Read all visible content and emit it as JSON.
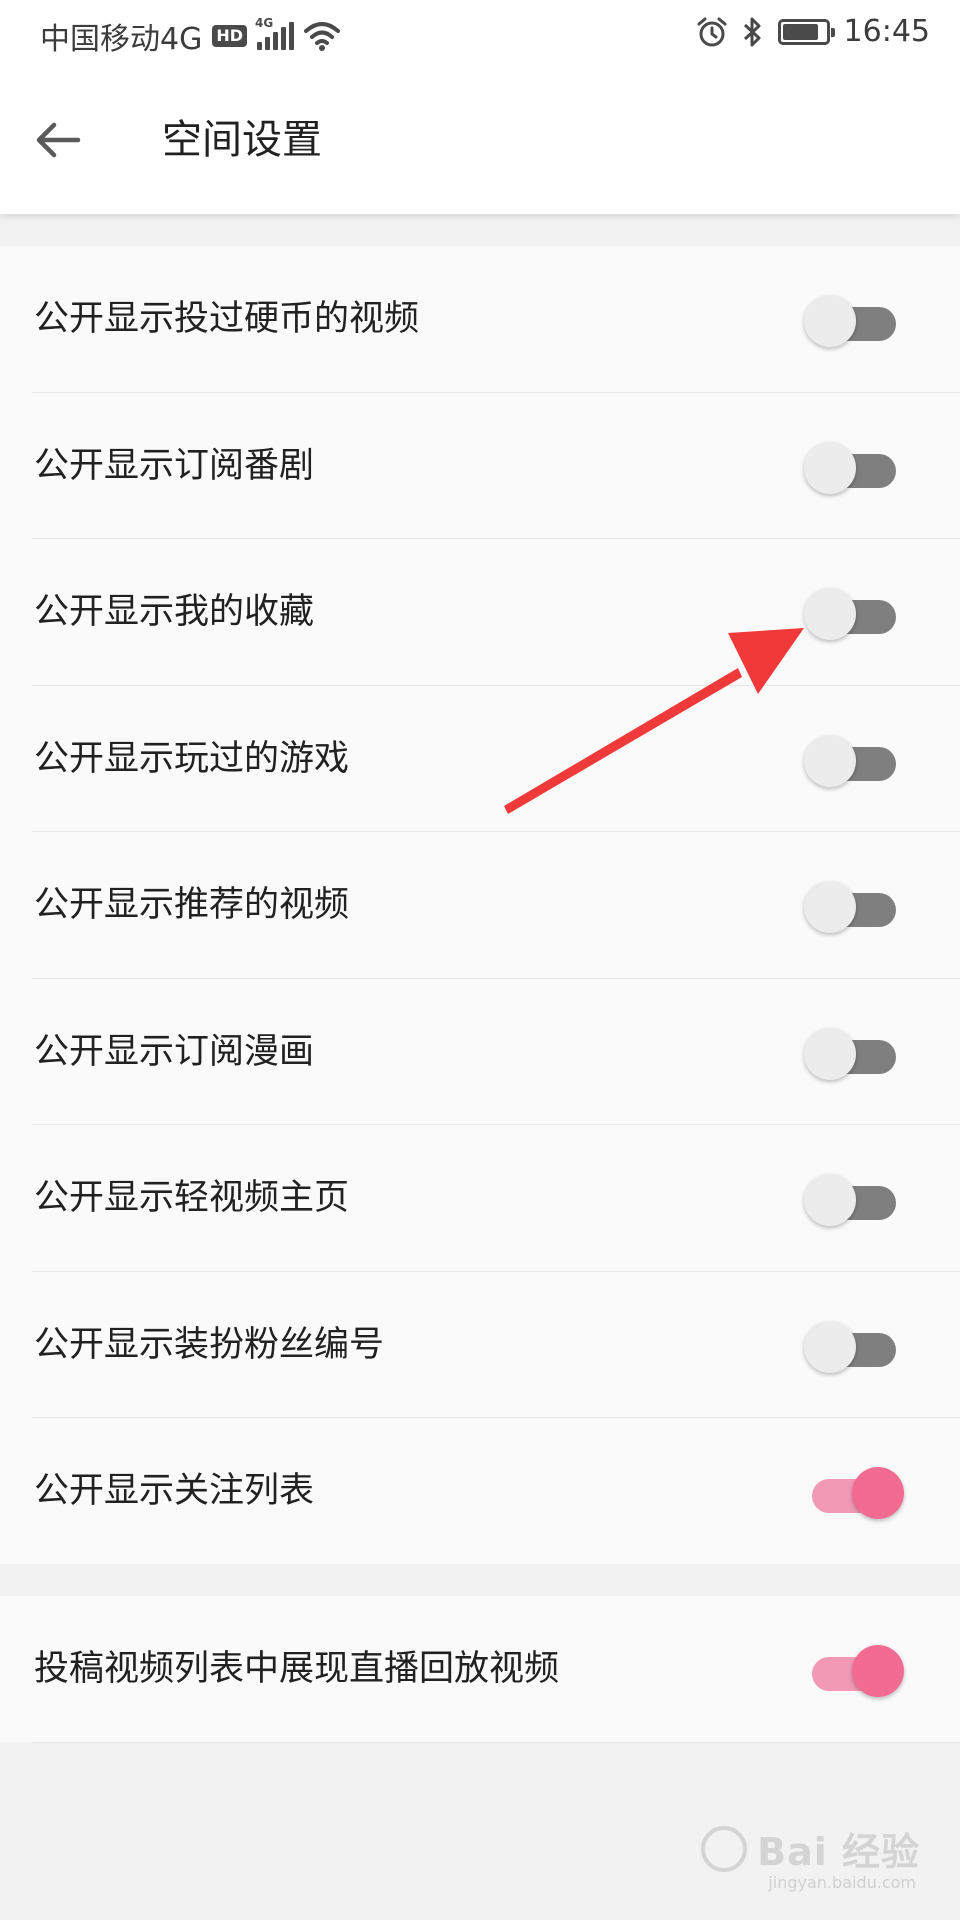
{
  "status_bar": {
    "carrier": "中国移动4G",
    "hd_badge": "HD",
    "signal_tag": "4G",
    "time": "16:45",
    "battery_level": 0.85,
    "icons": [
      "hd-icon",
      "signal-icon",
      "wifi-icon",
      "alarm-icon",
      "bluetooth-icon",
      "battery-icon"
    ]
  },
  "header": {
    "back_icon": "arrow-left-icon",
    "title": "空间设置"
  },
  "settings": {
    "items": [
      {
        "label": "公开显示投过硬币的视频",
        "enabled": false
      },
      {
        "label": "公开显示订阅番剧",
        "enabled": false
      },
      {
        "label": "公开显示我的收藏",
        "enabled": false
      },
      {
        "label": "公开显示玩过的游戏",
        "enabled": false
      },
      {
        "label": "公开显示推荐的视频",
        "enabled": false
      },
      {
        "label": "公开显示订阅漫画",
        "enabled": false
      },
      {
        "label": "公开显示轻视频主页",
        "enabled": false
      },
      {
        "label": "公开显示装扮粉丝编号",
        "enabled": false
      },
      {
        "label": "公开显示关注列表",
        "enabled": true
      }
    ],
    "extra_item": {
      "label": "投稿视频列表中展现直播回放视频",
      "enabled": true
    }
  },
  "colors": {
    "switch_on_thumb": "#f26b93",
    "switch_on_track": "#f29ab5",
    "switch_off_thumb": "#ececec",
    "switch_off_track": "#7f7f7f",
    "annotation_arrow": "#f03a3a"
  },
  "watermark": {
    "brand": "Bai 经验",
    "site": "jingyan.baidu.com"
  }
}
